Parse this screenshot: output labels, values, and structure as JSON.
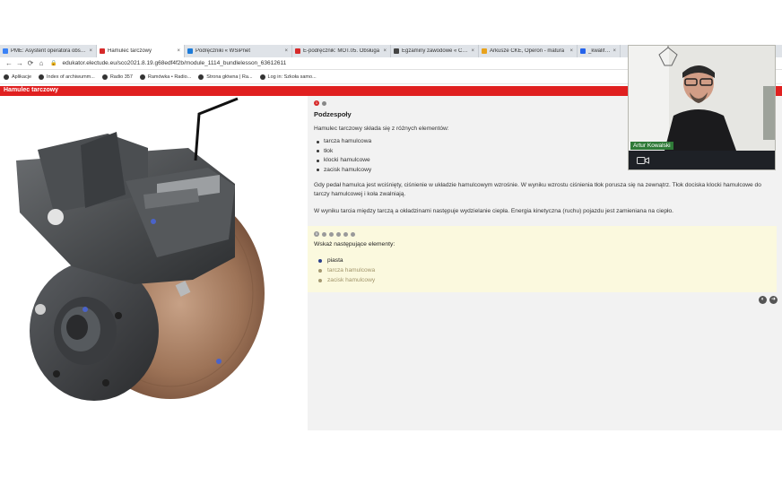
{
  "browser": {
    "tabs": [
      {
        "label": "PME: Asystent operatora obsługi",
        "favicon_color": "#3b82f6",
        "active": false
      },
      {
        "label": "Hamulec tarczowy",
        "favicon_color": "#d62a2a",
        "active": true
      },
      {
        "label": "Podręczniki « WSiPnet",
        "favicon_color": "#1d7bd8",
        "active": false
      },
      {
        "label": "E-podręcznik: MOT.05. Obsługa",
        "favicon_color": "#d62a2a",
        "active": false
      },
      {
        "label": "Egzaminy zawodowe « CKE",
        "favicon_color": "#444444",
        "active": false
      },
      {
        "label": "Arkusze CKE, Operon - matura",
        "favicon_color": "#e8a21c",
        "active": false
      },
      {
        "label": "_kwalifikacje",
        "favicon_color": "#2563eb",
        "active": false
      }
    ],
    "url": "edukator.electude.eu/sco2021.8.19.g68edf4f2b/module_1114_bundlelesson_63612611",
    "bookmarks": [
      {
        "label": "Aplikacje"
      },
      {
        "label": "Index of archiwumm..."
      },
      {
        "label": "Radio 357"
      },
      {
        "label": "Ramówka • Radio..."
      },
      {
        "label": "Strona główna | Ra..."
      },
      {
        "label": "Log in: Szkoła samo..."
      }
    ]
  },
  "app": {
    "title": "Hamulec tarczowy",
    "accent": "#e02020"
  },
  "lesson": {
    "step_number": "1",
    "heading": "Podzespoły",
    "intro": "Hamulec tarczowy składa się z różnych elementów:",
    "items": [
      "tarcza hamulcowa",
      "tłok",
      "klocki hamulcowe",
      "zacisk hamulcowy"
    ],
    "para1": "Gdy pedał hamulca jest wciśnięty, ciśnienie w układzie hamulcowym wzrośnie. W wyniku wzrostu ciśnienia tłok porusza się na zewnątrz. Tłok dociska klocki hamulcowe do tarczy hamulcowej i koła zwalniają.",
    "para2": "W wyniku tarcia między tarczą a okładzinami następuje wydzielanie ciepła. Energia kinetyczna (ruchu) pojazdu jest zamieniana na ciepło."
  },
  "quiz": {
    "step_number": "5",
    "prompt": "Wskaż następujące elementy:",
    "items": [
      {
        "label": "piasta",
        "color": "#222222",
        "dot_color": "#2b3f8c"
      },
      {
        "label": "tarcza hamulcowa",
        "color": "#a1946a",
        "dot_color": "#a59a72"
      },
      {
        "label": "zacisk hamulcowy",
        "color": "#a1946a",
        "dot_color": "#a59a72"
      }
    ]
  },
  "webcam": {
    "name": "Artur Kowalski"
  }
}
